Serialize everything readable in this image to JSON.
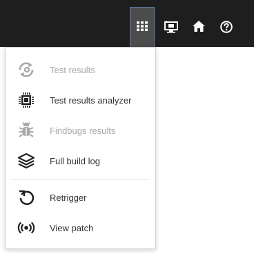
{
  "toolbar": {
    "buttons": [
      {
        "icon": "apps-grid-icon",
        "active": true
      },
      {
        "icon": "monitor-icon",
        "active": false
      },
      {
        "icon": "home-icon",
        "active": false
      },
      {
        "icon": "help-icon",
        "active": false
      }
    ]
  },
  "menu": {
    "items": [
      {
        "label": "Test results",
        "icon": "test-results-icon",
        "enabled": false
      },
      {
        "label": "Test results analyzer",
        "icon": "chip-icon",
        "enabled": true
      },
      {
        "label": "Findbugs results",
        "icon": "bug-icon",
        "enabled": false
      },
      {
        "label": "Full build log",
        "icon": "layers-icon",
        "enabled": true
      },
      {
        "label": "Retrigger",
        "icon": "retrigger-icon",
        "enabled": true
      },
      {
        "label": "View patch",
        "icon": "broadcast-icon",
        "enabled": true
      }
    ]
  },
  "colors": {
    "topbar": "#1e1e1e",
    "active_button": "#4c4c4c",
    "text": "#333333",
    "disabled_text": "#a8a8a8"
  }
}
